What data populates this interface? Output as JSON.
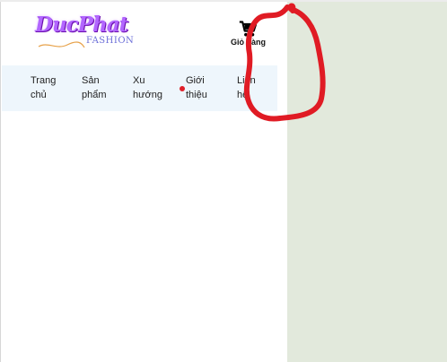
{
  "logo": {
    "script": "DucPhat",
    "sub": "FASHION",
    "color": "#b266ff"
  },
  "cart": {
    "label": "Giỏ hàng",
    "icon": "shopping-cart-icon"
  },
  "nav": {
    "items": [
      {
        "line1": "Trang",
        "line2": "chủ"
      },
      {
        "line1": "Sản",
        "line2": "phẩm"
      },
      {
        "line1": "Xu",
        "line2": "hướng"
      },
      {
        "line1": "Giới",
        "line2": "thiệu"
      },
      {
        "line1": "Liên",
        "line2": "hệ"
      }
    ],
    "background": "#eef6fc"
  },
  "colors": {
    "outside": "#e2e9dc",
    "annotation": "#e01b24",
    "active_dot": "#e0202a"
  }
}
